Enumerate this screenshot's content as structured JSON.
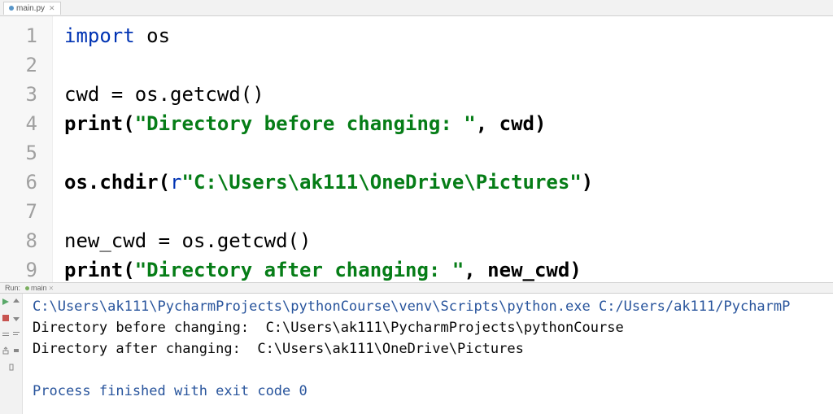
{
  "tab": {
    "filename": "main.py"
  },
  "code": {
    "lines": [
      {
        "num": "1",
        "tokens": [
          {
            "t": "import ",
            "c": "k-import"
          },
          {
            "t": "os",
            "c": "k-name"
          }
        ]
      },
      {
        "num": "2",
        "tokens": []
      },
      {
        "num": "3",
        "tokens": [
          {
            "t": "cwd = os.getcwd()",
            "c": "k-call"
          }
        ]
      },
      {
        "num": "4",
        "tokens": [
          {
            "t": "print(",
            "c": "k-call bold"
          },
          {
            "t": "\"Directory before changing: \"",
            "c": "k-str"
          },
          {
            "t": ", cwd)",
            "c": "k-call bold"
          }
        ]
      },
      {
        "num": "5",
        "tokens": []
      },
      {
        "num": "6",
        "tokens": [
          {
            "t": "os.chdir(",
            "c": "k-call bold"
          },
          {
            "t": "r",
            "c": "k-prefix"
          },
          {
            "t": "\"C:\\Users\\ak111\\OneDrive\\Pictures\"",
            "c": "k-str"
          },
          {
            "t": ")",
            "c": "k-call bold"
          }
        ]
      },
      {
        "num": "7",
        "tokens": []
      },
      {
        "num": "8",
        "tokens": [
          {
            "t": "new_cwd = os.getcwd()",
            "c": "k-call"
          }
        ]
      },
      {
        "num": "9",
        "tokens": [
          {
            "t": "print(",
            "c": "k-call bold"
          },
          {
            "t": "\"Directory after changing: \"",
            "c": "k-str"
          },
          {
            "t": ", new_cwd)",
            "c": "k-call bold"
          }
        ]
      }
    ]
  },
  "run": {
    "label": "Run:",
    "tab": "main",
    "lines": [
      {
        "text": "C:\\Users\\ak111\\PycharmProjects\\pythonCourse\\venv\\Scripts\\python.exe C:/Users/ak111/PycharmP",
        "cls": "cmd"
      },
      {
        "text": "Directory before changing:  C:\\Users\\ak111\\PycharmProjects\\pythonCourse",
        "cls": ""
      },
      {
        "text": "Directory after changing:  C:\\Users\\ak111\\OneDrive\\Pictures",
        "cls": ""
      },
      {
        "text": "",
        "cls": ""
      },
      {
        "text": "Process finished with exit code 0",
        "cls": "status"
      }
    ]
  }
}
